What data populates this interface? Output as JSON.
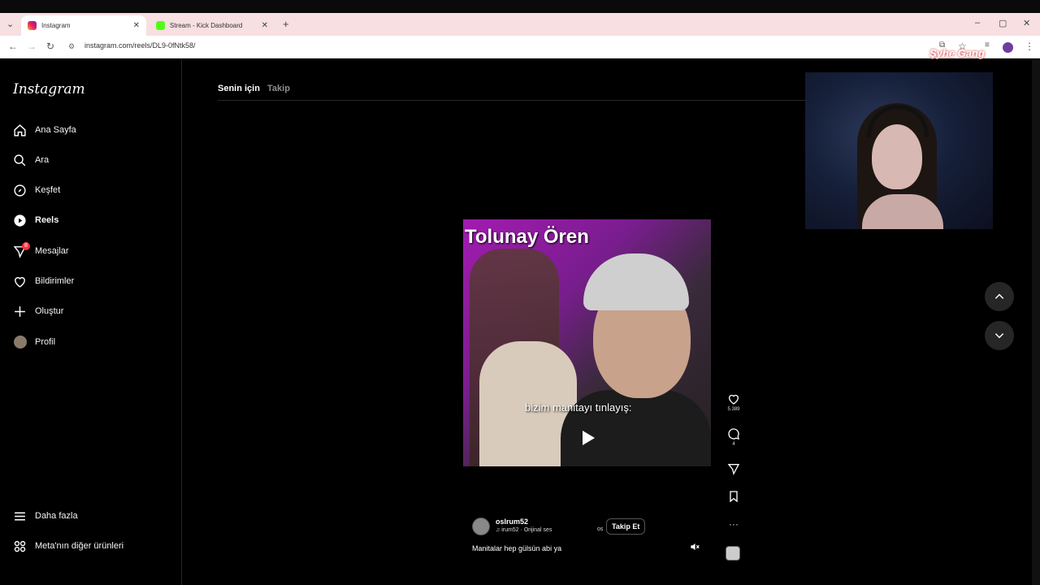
{
  "browser": {
    "tabs": [
      {
        "title": "Instagram",
        "active": true
      },
      {
        "title": "Stream - Kick Dashboard",
        "active": false
      }
    ],
    "url": "instagram.com/reels/DL9-0fNtk58/"
  },
  "instagram": {
    "logo": "Instagram",
    "nav": [
      {
        "label": "Ana Sayfa",
        "icon": "home-icon"
      },
      {
        "label": "Ara",
        "icon": "search-icon"
      },
      {
        "label": "Keşfet",
        "icon": "compass-icon"
      },
      {
        "label": "Reels",
        "icon": "reels-icon",
        "active": true
      },
      {
        "label": "Mesajlar",
        "icon": "messenger-icon",
        "badge": "8"
      },
      {
        "label": "Bildirimler",
        "icon": "heart-icon"
      },
      {
        "label": "Oluştur",
        "icon": "plus-icon"
      },
      {
        "label": "Profil",
        "icon": "avatar-icon"
      }
    ],
    "bottom_nav": [
      {
        "label": "Daha fazla",
        "icon": "menu-icon"
      },
      {
        "label": "Meta'nın diğer ürünleri",
        "icon": "grid-icon"
      }
    ],
    "feed_tabs": {
      "for_you": "Senin için",
      "following": "Takip"
    }
  },
  "reel": {
    "title_overlay": "Tolunay Ören",
    "caption_overlay": "bizim manitayı tınlayış:",
    "username": "oslrum52",
    "audio": "irum52 · Orijinal ses",
    "audio_tail": "os",
    "follow_label": "Takip Et",
    "description": "Manitalar hep gülsün abi ya",
    "likes": "5.389",
    "comments": "4"
  },
  "overlay": {
    "brand": "Şyhe Gang"
  },
  "colors": {
    "background": "#000000",
    "tab_bar": "#f7dfe2",
    "notification_red": "#ff3040",
    "reel_accent": "#a21bb0"
  }
}
